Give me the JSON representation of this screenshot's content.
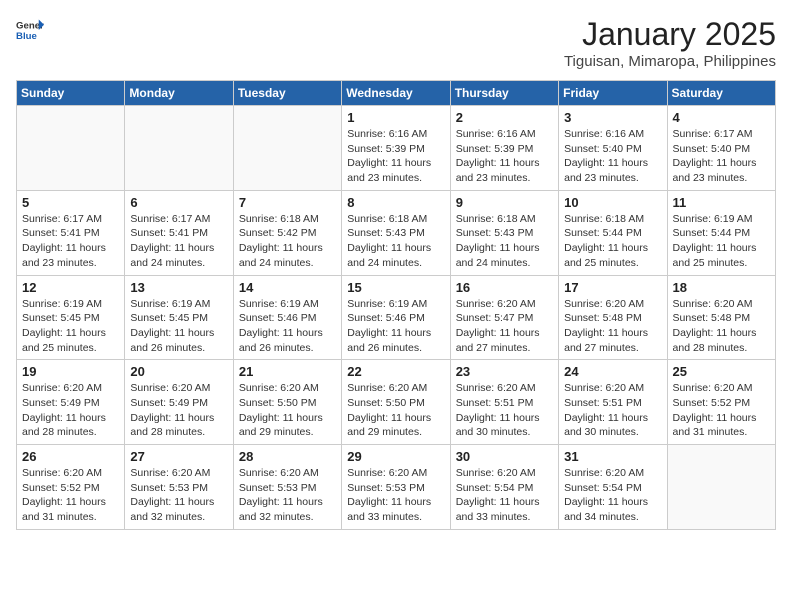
{
  "header": {
    "logo": {
      "general": "General",
      "blue": "Blue"
    },
    "title": "January 2025",
    "location": "Tiguisan, Mimaropa, Philippines"
  },
  "calendar": {
    "days_of_week": [
      "Sunday",
      "Monday",
      "Tuesday",
      "Wednesday",
      "Thursday",
      "Friday",
      "Saturday"
    ],
    "weeks": [
      [
        {
          "day": "",
          "info": ""
        },
        {
          "day": "",
          "info": ""
        },
        {
          "day": "",
          "info": ""
        },
        {
          "day": "1",
          "info": "Sunrise: 6:16 AM\nSunset: 5:39 PM\nDaylight: 11 hours and 23 minutes."
        },
        {
          "day": "2",
          "info": "Sunrise: 6:16 AM\nSunset: 5:39 PM\nDaylight: 11 hours and 23 minutes."
        },
        {
          "day": "3",
          "info": "Sunrise: 6:16 AM\nSunset: 5:40 PM\nDaylight: 11 hours and 23 minutes."
        },
        {
          "day": "4",
          "info": "Sunrise: 6:17 AM\nSunset: 5:40 PM\nDaylight: 11 hours and 23 minutes."
        }
      ],
      [
        {
          "day": "5",
          "info": "Sunrise: 6:17 AM\nSunset: 5:41 PM\nDaylight: 11 hours and 23 minutes."
        },
        {
          "day": "6",
          "info": "Sunrise: 6:17 AM\nSunset: 5:41 PM\nDaylight: 11 hours and 24 minutes."
        },
        {
          "day": "7",
          "info": "Sunrise: 6:18 AM\nSunset: 5:42 PM\nDaylight: 11 hours and 24 minutes."
        },
        {
          "day": "8",
          "info": "Sunrise: 6:18 AM\nSunset: 5:43 PM\nDaylight: 11 hours and 24 minutes."
        },
        {
          "day": "9",
          "info": "Sunrise: 6:18 AM\nSunset: 5:43 PM\nDaylight: 11 hours and 24 minutes."
        },
        {
          "day": "10",
          "info": "Sunrise: 6:18 AM\nSunset: 5:44 PM\nDaylight: 11 hours and 25 minutes."
        },
        {
          "day": "11",
          "info": "Sunrise: 6:19 AM\nSunset: 5:44 PM\nDaylight: 11 hours and 25 minutes."
        }
      ],
      [
        {
          "day": "12",
          "info": "Sunrise: 6:19 AM\nSunset: 5:45 PM\nDaylight: 11 hours and 25 minutes."
        },
        {
          "day": "13",
          "info": "Sunrise: 6:19 AM\nSunset: 5:45 PM\nDaylight: 11 hours and 26 minutes."
        },
        {
          "day": "14",
          "info": "Sunrise: 6:19 AM\nSunset: 5:46 PM\nDaylight: 11 hours and 26 minutes."
        },
        {
          "day": "15",
          "info": "Sunrise: 6:19 AM\nSunset: 5:46 PM\nDaylight: 11 hours and 26 minutes."
        },
        {
          "day": "16",
          "info": "Sunrise: 6:20 AM\nSunset: 5:47 PM\nDaylight: 11 hours and 27 minutes."
        },
        {
          "day": "17",
          "info": "Sunrise: 6:20 AM\nSunset: 5:48 PM\nDaylight: 11 hours and 27 minutes."
        },
        {
          "day": "18",
          "info": "Sunrise: 6:20 AM\nSunset: 5:48 PM\nDaylight: 11 hours and 28 minutes."
        }
      ],
      [
        {
          "day": "19",
          "info": "Sunrise: 6:20 AM\nSunset: 5:49 PM\nDaylight: 11 hours and 28 minutes."
        },
        {
          "day": "20",
          "info": "Sunrise: 6:20 AM\nSunset: 5:49 PM\nDaylight: 11 hours and 28 minutes."
        },
        {
          "day": "21",
          "info": "Sunrise: 6:20 AM\nSunset: 5:50 PM\nDaylight: 11 hours and 29 minutes."
        },
        {
          "day": "22",
          "info": "Sunrise: 6:20 AM\nSunset: 5:50 PM\nDaylight: 11 hours and 29 minutes."
        },
        {
          "day": "23",
          "info": "Sunrise: 6:20 AM\nSunset: 5:51 PM\nDaylight: 11 hours and 30 minutes."
        },
        {
          "day": "24",
          "info": "Sunrise: 6:20 AM\nSunset: 5:51 PM\nDaylight: 11 hours and 30 minutes."
        },
        {
          "day": "25",
          "info": "Sunrise: 6:20 AM\nSunset: 5:52 PM\nDaylight: 11 hours and 31 minutes."
        }
      ],
      [
        {
          "day": "26",
          "info": "Sunrise: 6:20 AM\nSunset: 5:52 PM\nDaylight: 11 hours and 31 minutes."
        },
        {
          "day": "27",
          "info": "Sunrise: 6:20 AM\nSunset: 5:53 PM\nDaylight: 11 hours and 32 minutes."
        },
        {
          "day": "28",
          "info": "Sunrise: 6:20 AM\nSunset: 5:53 PM\nDaylight: 11 hours and 32 minutes."
        },
        {
          "day": "29",
          "info": "Sunrise: 6:20 AM\nSunset: 5:53 PM\nDaylight: 11 hours and 33 minutes."
        },
        {
          "day": "30",
          "info": "Sunrise: 6:20 AM\nSunset: 5:54 PM\nDaylight: 11 hours and 33 minutes."
        },
        {
          "day": "31",
          "info": "Sunrise: 6:20 AM\nSunset: 5:54 PM\nDaylight: 11 hours and 34 minutes."
        },
        {
          "day": "",
          "info": ""
        }
      ]
    ]
  }
}
